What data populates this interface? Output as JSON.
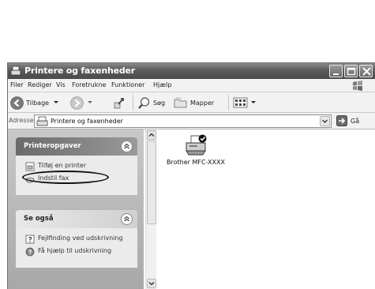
{
  "window": {
    "title": "Printere og faxenheder",
    "icon": "printers-folder-icon"
  },
  "menubar": {
    "items": [
      "Filer",
      "Rediger",
      "Vis",
      "Foretrukne",
      "Funktioner",
      "Hjælp"
    ]
  },
  "toolbar": {
    "back_label": "Tilbage",
    "search_label": "Søg",
    "folders_label": "Mapper"
  },
  "address": {
    "label": "Adresse",
    "value": "Printere og faxenheder",
    "go_label": "Gå"
  },
  "tasks_panel": {
    "title": "Printeropgaver",
    "items": [
      {
        "label": "Tilføj en printer",
        "icon": "add-printer-icon"
      },
      {
        "label": "Indstil fax",
        "icon": "fax-icon"
      }
    ]
  },
  "see_also_panel": {
    "title": "Se også",
    "items": [
      {
        "label": "Fejlfinding ved udskrivning",
        "icon": "help-question-icon"
      },
      {
        "label": "Få hjælp til udskrivning",
        "icon": "help-circle-icon"
      }
    ]
  },
  "printers": [
    {
      "name": "Brother MFC-XXXX",
      "icon": "printer-icon"
    }
  ]
}
